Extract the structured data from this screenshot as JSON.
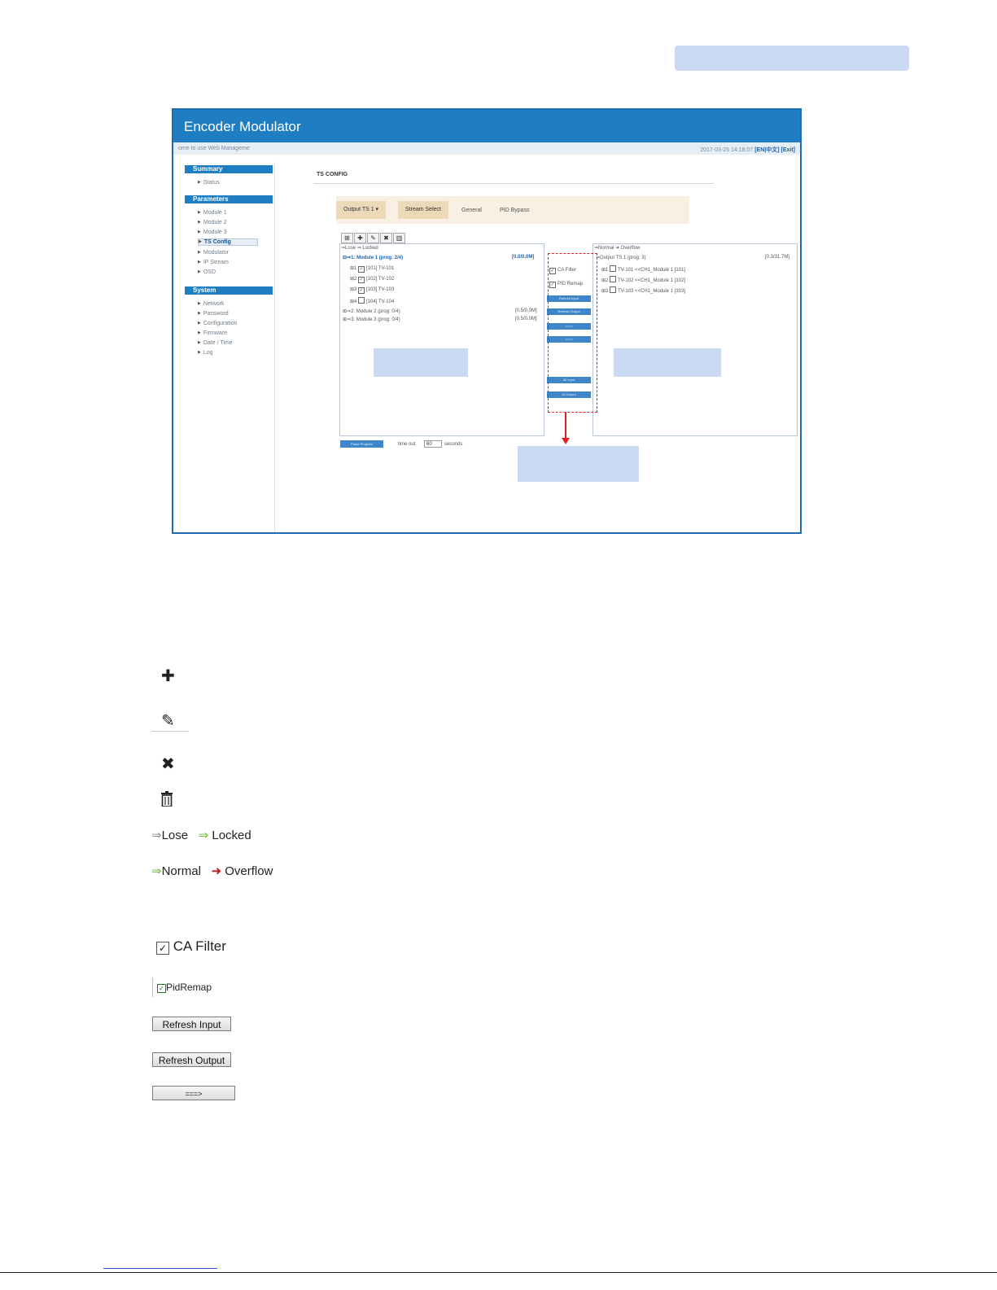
{
  "app": {
    "title": "Encoder Modulator",
    "welcome": "ome to use Web Manageme",
    "datetime": "2017-03-25 14:18:07",
    "lang": "[EN|中文]",
    "exit": "[Exit]"
  },
  "sidebar": {
    "summary": {
      "heading": "Summary",
      "items": [
        "Status"
      ]
    },
    "parameters": {
      "heading": "Parameters",
      "items": [
        "Module 1",
        "Module 2",
        "Module 3",
        "TS Config",
        "Modulator",
        "IP Stream",
        "OSD"
      ]
    },
    "system": {
      "heading": "System",
      "items": [
        "Network",
        "Password",
        "Configuration",
        "Firmware",
        "Date / Time",
        "Log"
      ]
    }
  },
  "content": {
    "title": "TS CONFIG",
    "tabs": [
      "Output TS 1 ▾",
      "Stream Select",
      "General",
      "PID Bypass"
    ],
    "input_legend": "⇒Lose  ⇒ Locked",
    "output_legend": "⇒Normal  ➜ Overflow",
    "input_tree": {
      "module1": "1: Module 1 (prog: 2/4)",
      "module1_rate": "[0.0/0.0M]",
      "programs": [
        "[101] TV-101",
        "[102] TV-102",
        "[103] TV-103",
        "[104] TV-104"
      ],
      "module2": "2: Module 2 (prog: 0/4)",
      "module2_rate": "[0.5/0.0M]",
      "module3": "3: Module 3 (prog: 0/4)",
      "module3_rate": "[0.5/0.0M]"
    },
    "output_tree": {
      "root": "Output TS 1 (prog: 3)",
      "root_rate": "[0.3/31.7M]",
      "programs": [
        "TV-101 <<CH1_Module 1 [101]",
        "TV-102 <<CH1_Module 1 [102]",
        "TV-103 <<CH1_Module 1 [103]"
      ]
    },
    "mid": {
      "ca_filter": "CA Filter",
      "pid_remap": "PID Remap",
      "buttons": [
        "Refresh Input",
        "Refresh Output",
        "===>",
        "<==="
      ],
      "all_buttons": [
        "All Input",
        "All Output"
      ]
    },
    "parse_button": "Parse Program",
    "timeout_label": "time out",
    "timeout_value": "60",
    "seconds_label": "seconds"
  },
  "legend": {
    "lose": "Lose",
    "locked": "Locked",
    "normal": "Normal",
    "overflow": "Overflow",
    "ca_filter": "CA Filter",
    "pid_remap": "PidRemap",
    "refresh_input": "Refresh Input",
    "refresh_output": "Refresh Output",
    "arrow_button": "===>"
  },
  "colors": {
    "header": "#1f7ec2",
    "callout": "#c9daf2",
    "highlight": "#e32020"
  }
}
